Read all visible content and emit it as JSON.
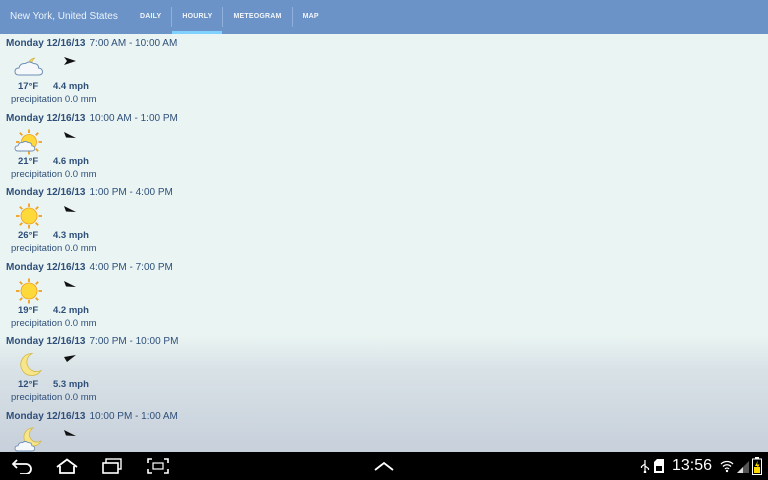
{
  "header": {
    "location": "New York, United States",
    "tabs": [
      {
        "label": "DAILY"
      },
      {
        "label": "HOURLY"
      },
      {
        "label": "METEOGRAM"
      },
      {
        "label": "MAP"
      }
    ],
    "active_tab": "HOURLY"
  },
  "forecast": [
    {
      "date": "Monday 12/16/13",
      "time": "7:00 AM - 10:00 AM",
      "icon": "partly-cloudy-icon",
      "temp": "17°F",
      "wind": "4.4 mph",
      "precip": "precipitation 0.0 mm"
    },
    {
      "date": "Monday 12/16/13",
      "time": "10:00 AM - 1:00 PM",
      "icon": "sun-cloud-icon",
      "temp": "21°F",
      "wind": "4.6 mph",
      "precip": "precipitation 0.0 mm"
    },
    {
      "date": "Monday 12/16/13",
      "time": "1:00 PM - 4:00 PM",
      "icon": "sun-icon",
      "temp": "26°F",
      "wind": "4.3 mph",
      "precip": "precipitation 0.0 mm"
    },
    {
      "date": "Monday 12/16/13",
      "time": "4:00 PM - 7:00 PM",
      "icon": "sun-icon",
      "temp": "19°F",
      "wind": "4.2 mph",
      "precip": "precipitation 0.0 mm"
    },
    {
      "date": "Monday 12/16/13",
      "time": "7:00 PM - 10:00 PM",
      "icon": "moon-icon",
      "temp": "12°F",
      "wind": "5.3 mph",
      "precip": "precipitation 0.0 mm"
    },
    {
      "date": "Monday 12/16/13",
      "time": "10:00 PM - 1:00 AM",
      "icon": "moon-cloud-icon",
      "temp": "",
      "wind": "",
      "precip": ""
    }
  ],
  "system_bar": {
    "time": "13:56",
    "buttons": [
      "back-icon",
      "home-icon",
      "recent-apps-icon",
      "screenshot-icon",
      "chevron-up-icon"
    ],
    "status_icons": [
      "usb-icon",
      "sd-card-icon",
      "wifi-icon",
      "signal-icon",
      "battery-icon"
    ]
  },
  "colors": {
    "header": "#6b93c7",
    "text": "#2f4f7a",
    "active_indicator": "#7fd2ff"
  }
}
